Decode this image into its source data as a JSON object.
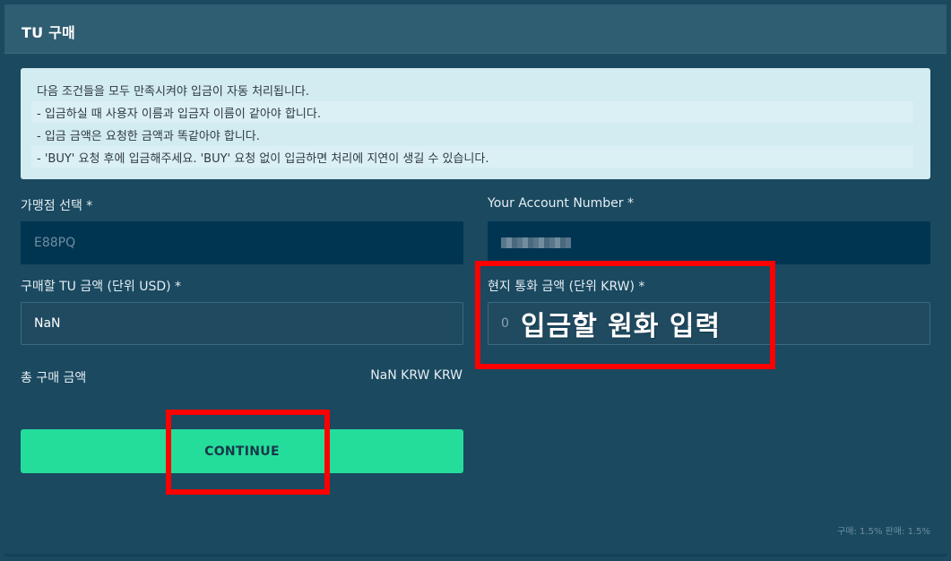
{
  "panel": {
    "title": "TU 구매"
  },
  "notice": {
    "lines": [
      "다음 조건들을 모두 만족시켜야 입금이 자동 처리됩니다.",
      "- 입금하실 때 사용자 이름과 입금자 이름이 같아야 합니다.",
      "- 입금 금액은 요청한 금액과 똑같아야 합니다.",
      "- 'BUY' 요청 후에 입금해주세요. 'BUY' 요청 없이 입금하면 처리에 지연이 생길 수 있습니다."
    ]
  },
  "form": {
    "store_label": "가맹점 선택 *",
    "store_value": "E88PQ",
    "account_label": "Your Account Number *",
    "tu_amount_label": "구매할 TU 금액 (단위 USD) *",
    "tu_amount_value": "NaN",
    "krw_amount_label": "현지 통화 금액 (단위 KRW) *",
    "krw_amount_value": "0",
    "total_label": "총 구매 금액",
    "total_value": "NaN KRW KRW"
  },
  "actions": {
    "continue_label": "CONTINUE"
  },
  "annotation": {
    "overlay_text": "입금할 원화 입력",
    "color": "#ff0000"
  },
  "fees": {
    "info": "구매: 1.5% 판매: 1.5%"
  },
  "colors": {
    "accent_button": "#25dd9a",
    "background": "#1a4960",
    "notice_bg": "#d2ecf1"
  }
}
